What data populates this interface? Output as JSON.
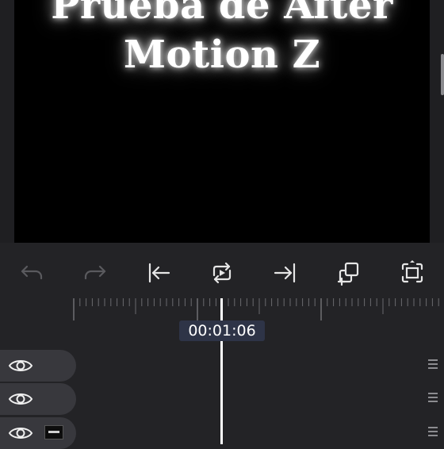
{
  "preview": {
    "title_line1": "Prueba de After",
    "title_line2": "Motion Z"
  },
  "toolbar": {
    "undo_icon": "undo-icon",
    "redo_icon": "redo-icon",
    "jump_start_icon": "jump-to-start-icon",
    "loop_play_icon": "loop-play-icon",
    "jump_end_icon": "jump-to-end-icon",
    "add_layer_icon": "copy-add-icon",
    "fit_screen_icon": "fit-screen-icon"
  },
  "timeline": {
    "timecode": "00:01:06",
    "layers": [
      {
        "visible": true,
        "has_thumbnail": false
      },
      {
        "visible": true,
        "has_thumbnail": false
      },
      {
        "visible": true,
        "has_thumbnail": true
      }
    ]
  },
  "colors": {
    "background": "#232326",
    "canvas": "#000000",
    "layer_pill": "#38383d",
    "timecode_bg": "#2e3447",
    "icon_enabled": "#e6e6e6",
    "icon_disabled": "#5a5a5e"
  }
}
